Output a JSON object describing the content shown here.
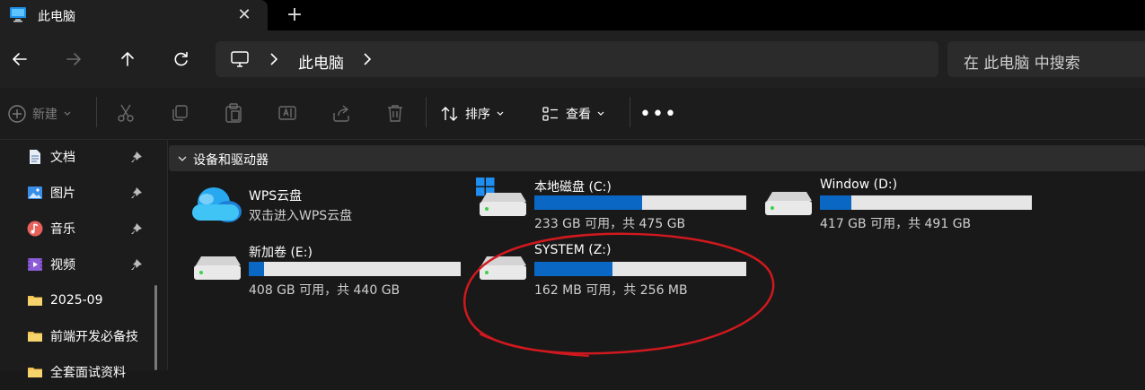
{
  "tab": {
    "title": "此电脑",
    "close_glyph": "✕",
    "new_tab_glyph": "+"
  },
  "address": {
    "location": "此电脑"
  },
  "search": {
    "placeholder": "在 此电脑 中搜索"
  },
  "toolbar": {
    "new_label": "新建",
    "sort_label": "排序",
    "view_label": "查看",
    "more_label": "•••"
  },
  "sidebar": {
    "items": [
      {
        "label": "文档",
        "icon": "document-icon",
        "pinned": true
      },
      {
        "label": "图片",
        "icon": "pictures-icon",
        "pinned": true
      },
      {
        "label": "音乐",
        "icon": "music-icon",
        "pinned": true
      },
      {
        "label": "视频",
        "icon": "video-icon",
        "pinned": true
      },
      {
        "label": "2025-09",
        "icon": "folder-icon",
        "pinned": false
      },
      {
        "label": "前端开发必备技",
        "icon": "folder-icon",
        "pinned": false
      },
      {
        "label": "全套面试资料",
        "icon": "folder-icon",
        "pinned": false
      }
    ]
  },
  "group": {
    "title": "设备和驱动器"
  },
  "wps": {
    "name": "WPS云盘",
    "subtitle": "双击进入WPS云盘"
  },
  "drives": [
    {
      "name": "本地磁盘 (C:)",
      "info": "233 GB 可用，共 475 GB",
      "used_fraction": 0.51,
      "system": true
    },
    {
      "name": "Window (D:)",
      "info": "417 GB 可用，共 491 GB",
      "used_fraction": 0.15,
      "system": false
    },
    {
      "name": "新加卷 (E:)",
      "info": "408 GB 可用，共 440 GB",
      "used_fraction": 0.07,
      "system": false
    },
    {
      "name": "SYSTEM (Z:)",
      "info": "162 MB 可用，共 256 MB",
      "used_fraction": 0.37,
      "system": false
    }
  ],
  "colors": {
    "accent": "#0a67c4",
    "annotation": "#d0191e",
    "folder": "#f2c14e"
  }
}
